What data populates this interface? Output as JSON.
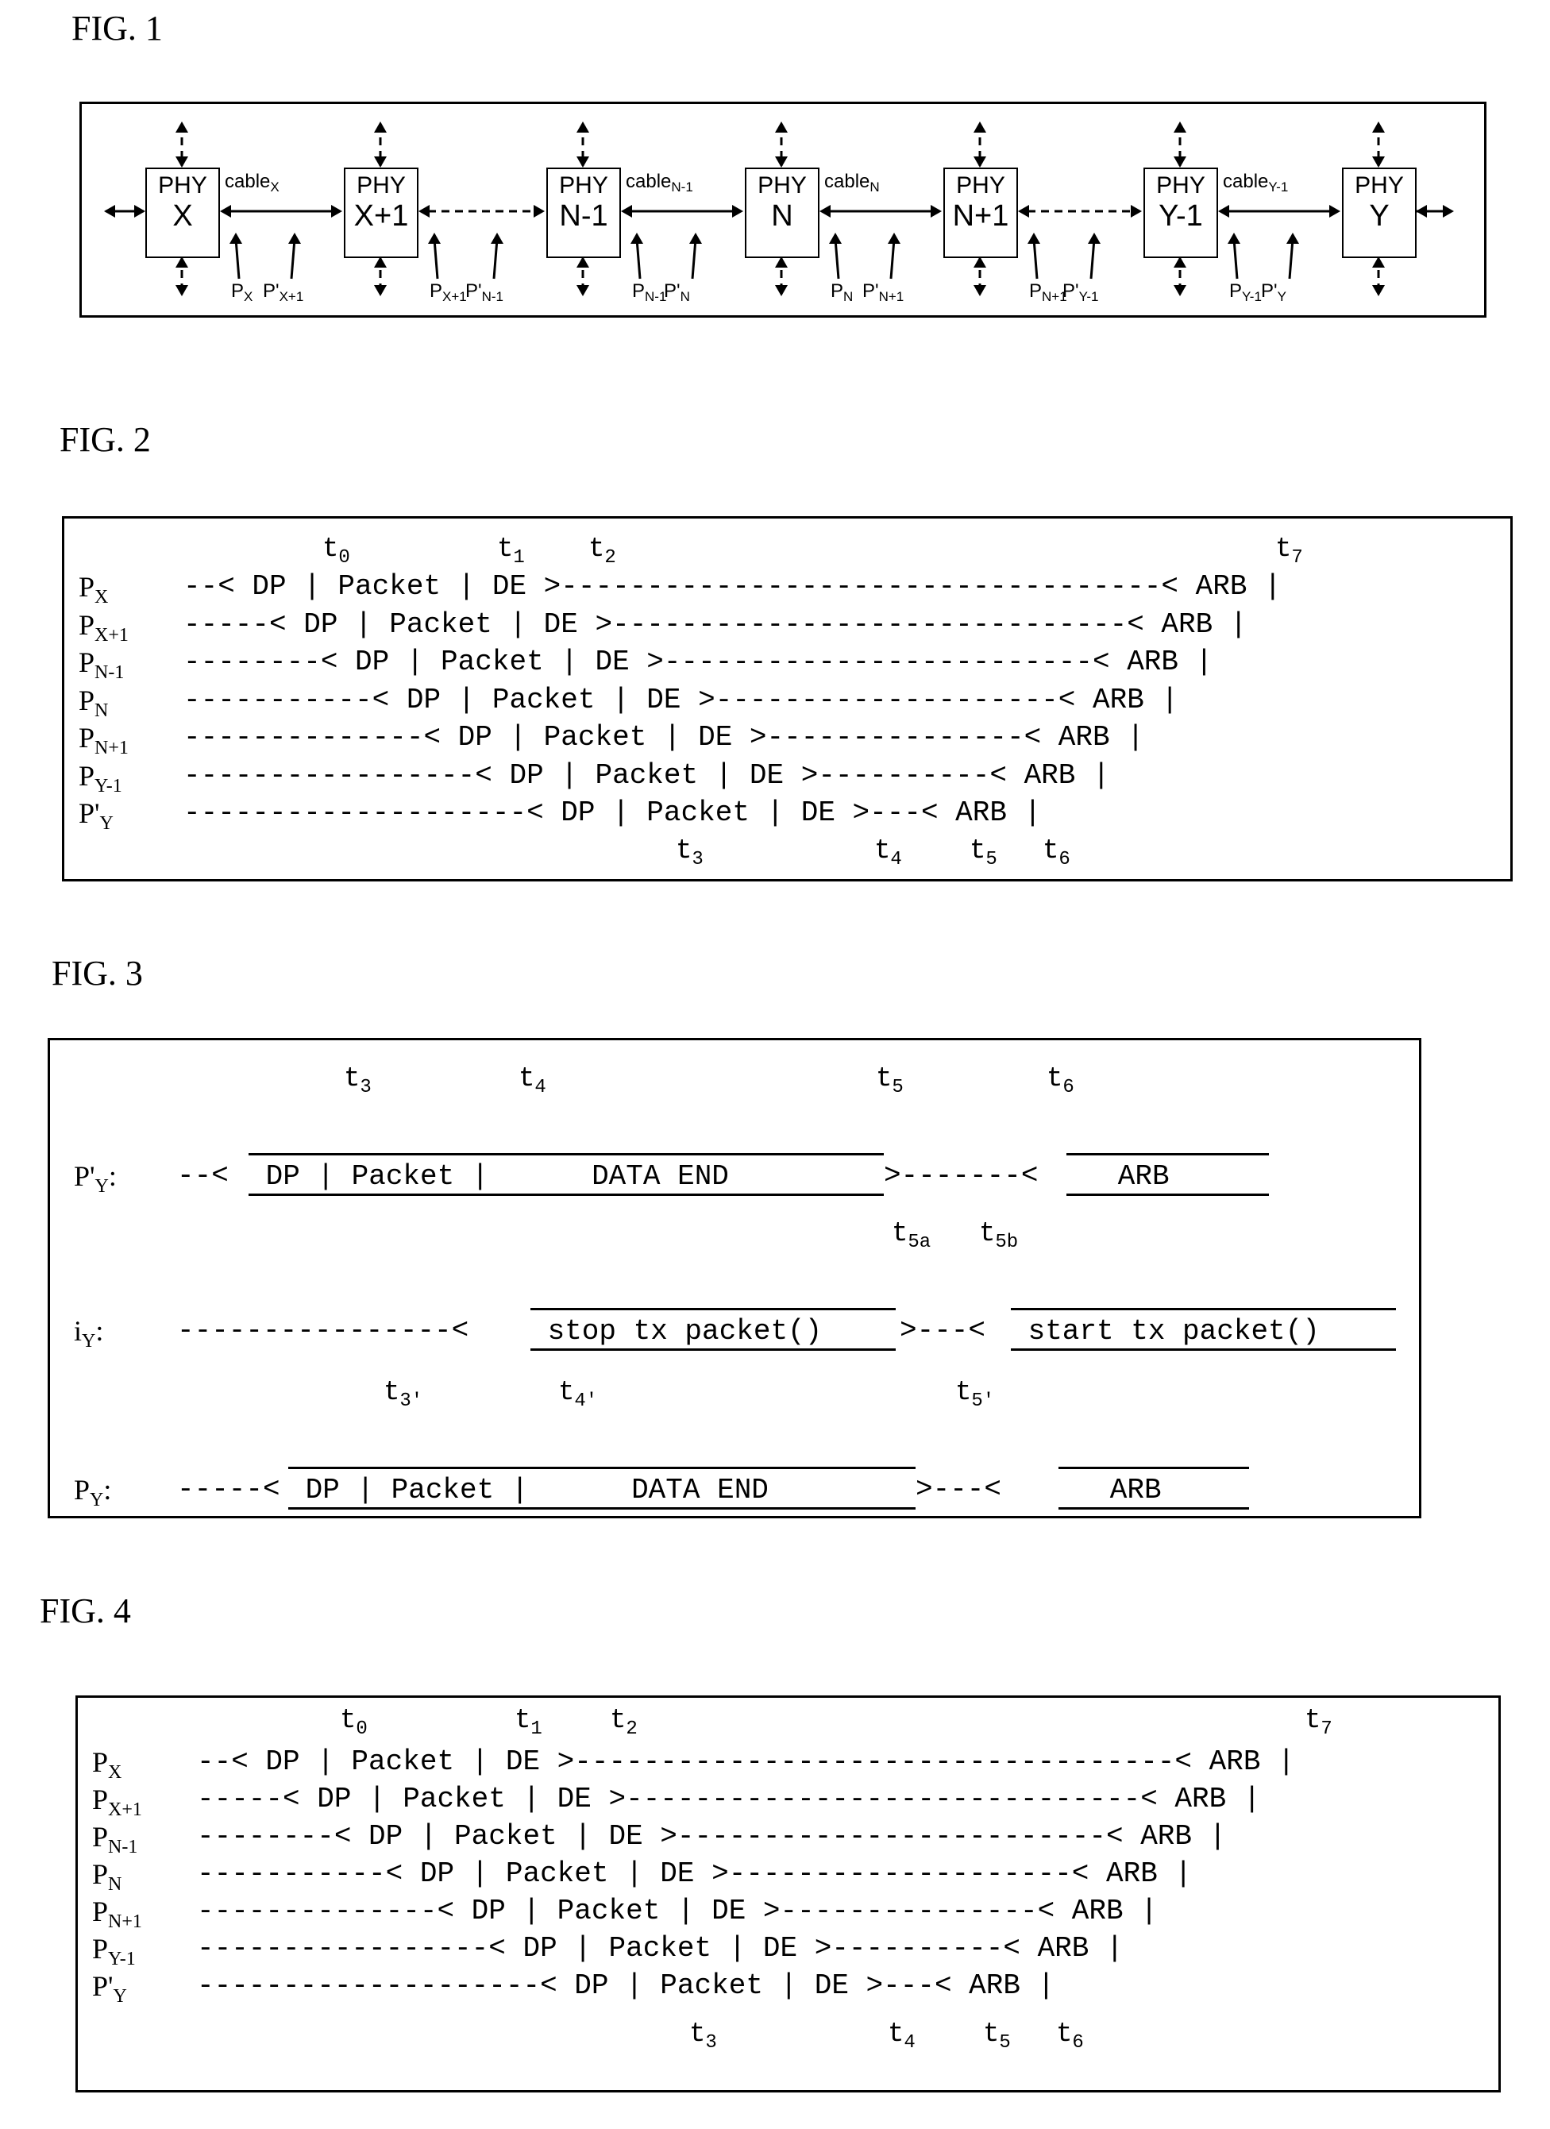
{
  "fig1": {
    "label": "FIG. 1",
    "nodes": [
      {
        "top": "PHY",
        "bottom": "X"
      },
      {
        "top": "PHY",
        "bottom": "X+1"
      },
      {
        "top": "PHY",
        "bottom": "N-1"
      },
      {
        "top": "PHY",
        "bottom": "N"
      },
      {
        "top": "PHY",
        "bottom": "N+1"
      },
      {
        "top": "PHY",
        "bottom": "Y-1"
      },
      {
        "top": "PHY",
        "bottom": "Y"
      }
    ],
    "cables": [
      {
        "base": "cable",
        "sub": "X"
      },
      {
        "base": "cable",
        "sub": "N-1"
      },
      {
        "base": "cable",
        "sub": "N"
      },
      {
        "base": "cable",
        "sub": "Y-1"
      }
    ],
    "ports": [
      {
        "base": "P",
        "sub": "X"
      },
      {
        "base": "P'",
        "sub": "X+1"
      },
      {
        "base": "P",
        "sub": "X+1"
      },
      {
        "base": "P'",
        "sub": "N-1"
      },
      {
        "base": "P",
        "sub": "N-1"
      },
      {
        "base": "P'",
        "sub": "N"
      },
      {
        "base": "P",
        "sub": "N"
      },
      {
        "base": "P'",
        "sub": "N+1"
      },
      {
        "base": "P",
        "sub": "N+1"
      },
      {
        "base": "P'",
        "sub": "Y-1"
      },
      {
        "base": "P",
        "sub": "Y-1"
      },
      {
        "base": "P'",
        "sub": "Y"
      }
    ]
  },
  "fig2": {
    "label": "FIG. 2",
    "top_times": [
      {
        "b": "t",
        "s": "0"
      },
      {
        "b": "t",
        "s": "1"
      },
      {
        "b": "t",
        "s": "2"
      },
      {
        "b": "t",
        "s": "7"
      }
    ],
    "bottom_times": [
      {
        "b": "t",
        "s": "3"
      },
      {
        "b": "t",
        "s": "4"
      },
      {
        "b": "t",
        "s": "5"
      },
      {
        "b": "t",
        "s": "6"
      }
    ],
    "rows": [
      {
        "sig": "P",
        "sub": "X",
        "line": "--< DP | Packet | DE >-----------------------------------< ARB |"
      },
      {
        "sig": "P",
        "sub": "X+1",
        "line": "-----< DP | Packet | DE >------------------------------< ARB |"
      },
      {
        "sig": "P",
        "sub": "N-1",
        "line": "--------< DP | Packet | DE >-------------------------< ARB |"
      },
      {
        "sig": "P",
        "sub": "N",
        "line": "-----------< DP | Packet | DE >--------------------< ARB |"
      },
      {
        "sig": "P",
        "sub": "N+1",
        "line": "--------------< DP | Packet | DE >---------------< ARB |"
      },
      {
        "sig": "P",
        "sub": "Y-1",
        "line": "-----------------< DP | Packet | DE >----------< ARB |"
      },
      {
        "sig": "P'",
        "sub": "Y",
        "line": "--------------------< DP | Packet | DE >---< ARB |"
      }
    ]
  },
  "fig3": {
    "label": "FIG. 3",
    "row1": {
      "sig": "P'",
      "sub": "Y",
      "suffix": ":",
      "times": [
        {
          "b": "t",
          "s": "3"
        },
        {
          "b": "t",
          "s": "4"
        },
        {
          "b": "t",
          "s": "5"
        },
        {
          "b": "t",
          "s": "6"
        }
      ],
      "lead": "--<",
      "seg1": " DP | Packet |      DATA END ",
      "mid": ">-------<",
      "seg2": "   ARB    "
    },
    "row2": {
      "sig": "i",
      "sub": "Y",
      "suffix": ":",
      "times": [
        {
          "b": "t",
          "s": "5a"
        },
        {
          "b": "t",
          "s": "5b"
        }
      ],
      "lead": "----------------<",
      "seg1": " stop tx packet() ",
      "mid": ">---<",
      "seg2": " start tx packet() "
    },
    "row3": {
      "sig": "P",
      "sub": "Y",
      "suffix": ":",
      "times": [
        {
          "b": "t",
          "s": "3′"
        },
        {
          "b": "t",
          "s": "4′"
        },
        {
          "b": "t",
          "s": "5′"
        }
      ],
      "lead": "-----<",
      "seg1": " DP | Packet |      DATA END  ",
      "mid": ">---<",
      "seg2": "   ARB    "
    }
  },
  "fig4": {
    "label": "FIG. 4",
    "top_times": [
      {
        "b": "t",
        "s": "0"
      },
      {
        "b": "t",
        "s": "1"
      },
      {
        "b": "t",
        "s": "2"
      },
      {
        "b": "t",
        "s": "7"
      }
    ],
    "bottom_times": [
      {
        "b": "t",
        "s": "3"
      },
      {
        "b": "t",
        "s": "4"
      },
      {
        "b": "t",
        "s": "5"
      },
      {
        "b": "t",
        "s": "6"
      }
    ],
    "rows": [
      {
        "sig": "P",
        "sub": "X",
        "line": "--< DP | Packet | DE >-----------------------------------< ARB |"
      },
      {
        "sig": "P",
        "sub": "X+1",
        "line": "-----< DP | Packet | DE >------------------------------< ARB |"
      },
      {
        "sig": "P",
        "sub": "N-1",
        "line": "--------< DP | Packet | DE >-------------------------< ARB |"
      },
      {
        "sig": "P",
        "sub": "N",
        "line": "-----------< DP | Packet | DE >--------------------< ARB |"
      },
      {
        "sig": "P",
        "sub": "N+1",
        "line": "--------------< DP | Packet | DE >---------------< ARB |"
      },
      {
        "sig": "P",
        "sub": "Y-1",
        "line": "-----------------< DP | Packet | DE >----------< ARB |"
      },
      {
        "sig": "P'",
        "sub": "Y",
        "line": "--------------------< DP | Packet | DE >---< ARB |"
      }
    ]
  }
}
